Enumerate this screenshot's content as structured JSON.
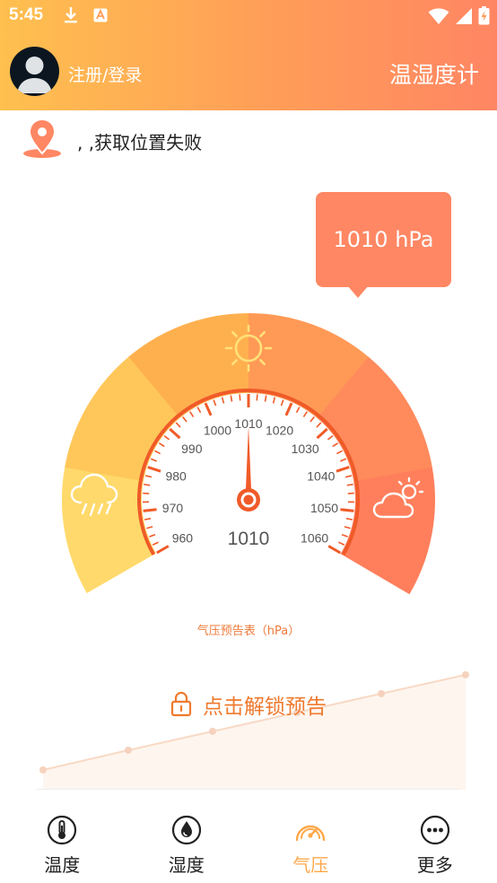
{
  "status_bar": {
    "time": "5:45",
    "icons": [
      "download-icon",
      "app-icon",
      "wifi-icon",
      "signal-icon",
      "battery-icon"
    ]
  },
  "header": {
    "login_label": "注册/登录",
    "app_title": "温湿度计",
    "gradient_colors": [
      "#ffc04f",
      "#ff9d58",
      "#ff8663"
    ]
  },
  "location": {
    "icon": "location-pin-icon",
    "text": ", ,获取位置失败"
  },
  "gauge": {
    "bubble_value": "1010 hPa",
    "center_value": "1010",
    "ticks": [
      "960",
      "970",
      "980",
      "990",
      "1000",
      "1010",
      "1020",
      "1030",
      "1040",
      "1050",
      "1060"
    ],
    "min": 960,
    "max": 1060,
    "current": 1010,
    "caption": "气压预告表（hPa）",
    "left_icon": "rain-cloud-icon",
    "top_icon": "sun-icon",
    "right_icon": "partly-cloudy-icon",
    "accent_color": "#f05a28"
  },
  "forecast": {
    "lock_icon": "lock-icon",
    "unlock_label": "点击解锁预告"
  },
  "bottom_nav": {
    "items": [
      {
        "label": "温度",
        "icon": "thermometer-icon"
      },
      {
        "label": "湿度",
        "icon": "water-drop-icon"
      },
      {
        "label": "气压",
        "icon": "pressure-gauge-icon"
      },
      {
        "label": "更多",
        "icon": "more-dots-icon"
      }
    ],
    "active_index": 2,
    "active_color": "#ffa84a"
  }
}
